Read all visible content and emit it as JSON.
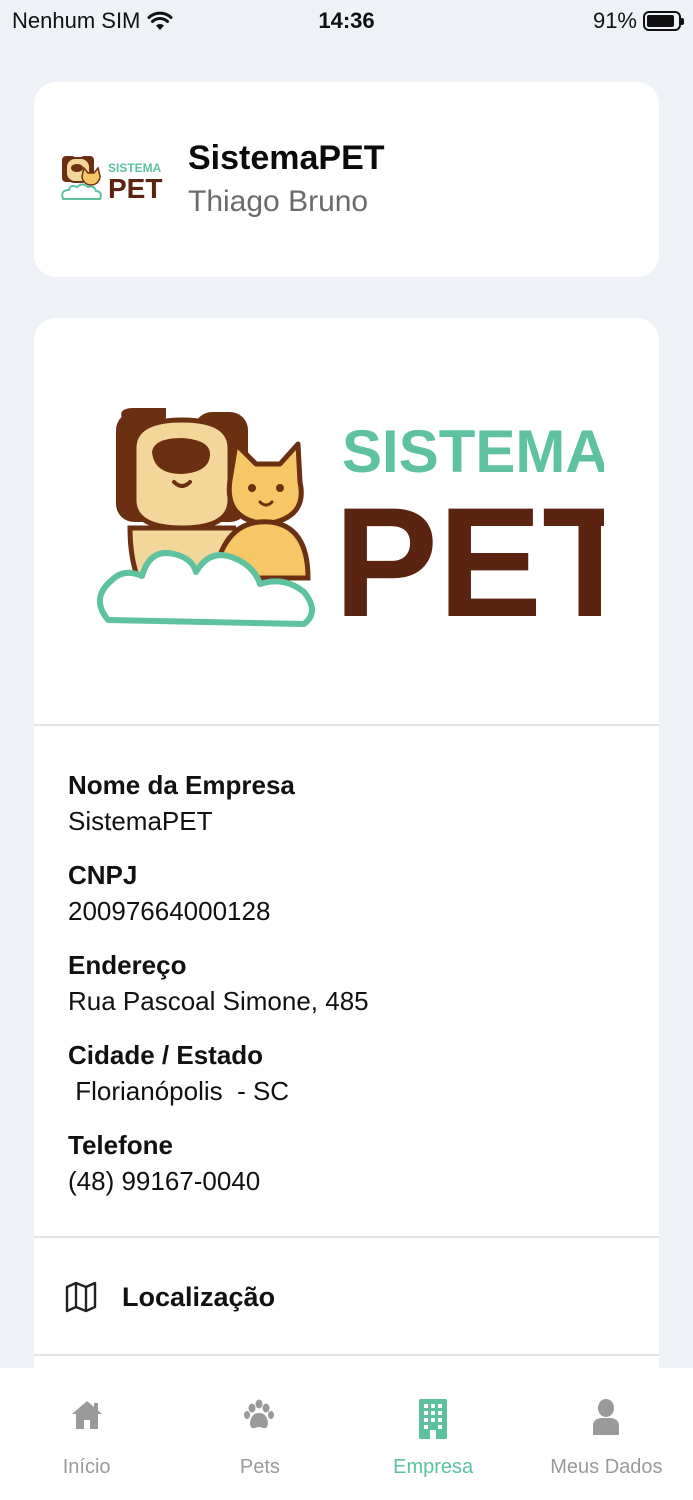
{
  "status_bar": {
    "carrier": "Nenhum SIM",
    "time": "14:36",
    "battery_percent": "91%",
    "battery_level": 0.91,
    "wifi_icon": "wifi-icon",
    "battery_icon": "battery-icon"
  },
  "header": {
    "title": "SistemaPET",
    "subtitle": "Thiago Bruno",
    "logo_small": {
      "line1": "SISTEMA",
      "line2": "PET"
    }
  },
  "company": {
    "logo": {
      "line1": "SISTEMA",
      "line2": "PET"
    },
    "fields": [
      {
        "label": "Nome da Empresa",
        "value": "SistemaPET"
      },
      {
        "label": "CNPJ",
        "value": "20097664000128"
      },
      {
        "label": "Endereço",
        "value": "Rua Pascoal Simone, 485"
      },
      {
        "label": "Cidade / Estado",
        "value": " Florianópolis  - SC"
      },
      {
        "label": "Telefone",
        "value": "(48) 99167-0040"
      }
    ],
    "location_label": "Localização",
    "location_icon": "map-icon"
  },
  "tabs": [
    {
      "label": "Início",
      "icon": "home-icon",
      "active": false
    },
    {
      "label": "Pets",
      "icon": "paw-icon",
      "active": false
    },
    {
      "label": "Empresa",
      "icon": "building-icon",
      "active": true
    },
    {
      "label": "Meus Dados",
      "icon": "user-icon",
      "active": false
    }
  ],
  "colors": {
    "background": "#eef1f6",
    "accent": "#5cc19c",
    "brand_brown": "#5a2410",
    "brand_teal": "#5ec29f",
    "tab_inactive": "#9a9a9a"
  }
}
